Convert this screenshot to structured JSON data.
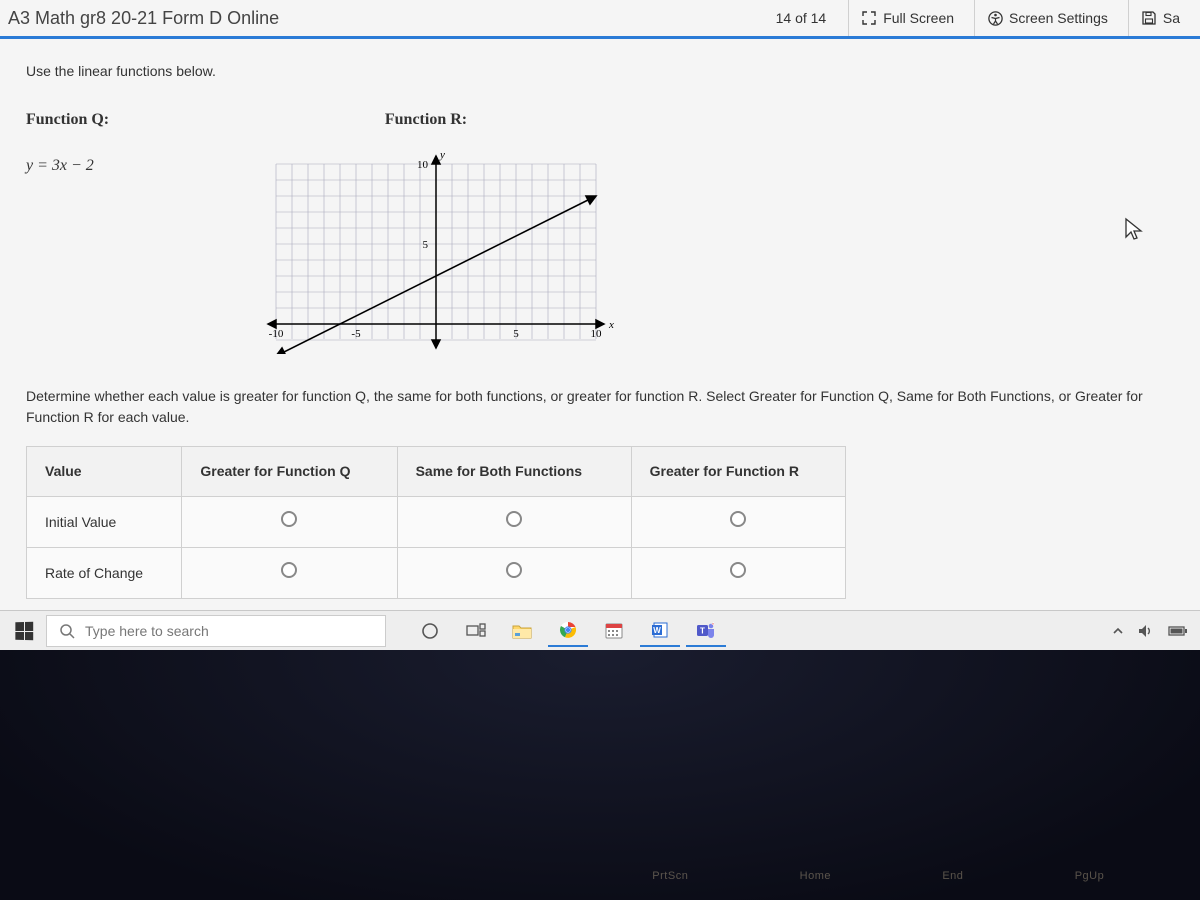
{
  "header": {
    "title": "A3 Math gr8 20-21 Form D Online",
    "page_counter": "14 of 14",
    "full_screen_label": "Full Screen",
    "screen_settings_label": "Screen Settings",
    "save_label": "Sa"
  },
  "question": {
    "prompt": "Use the linear functions below.",
    "function_q_label": "Function Q:",
    "function_q_equation": "y = 3x − 2",
    "function_r_label": "Function R:",
    "instructions": "Determine whether each value is greater for function Q, the same for both functions, or greater for function R. Select Greater for Function Q, Same for Both Functions, or Greater for Function R for each value."
  },
  "table": {
    "headers": [
      "Value",
      "Greater for Function Q",
      "Same for Both Functions",
      "Greater for Function R"
    ],
    "rows": [
      "Initial Value",
      "Rate of Change"
    ]
  },
  "chart_data": {
    "type": "line",
    "title": "Function R",
    "xlabel": "x",
    "ylabel": "y",
    "xlim": [
      -10,
      10
    ],
    "ylim": [
      -3,
      10
    ],
    "xticks": [
      -10,
      -5,
      5,
      10
    ],
    "yticks": [
      5,
      10
    ],
    "series": [
      {
        "name": "R",
        "points": [
          [
            -10,
            -2
          ],
          [
            10,
            8
          ]
        ]
      }
    ],
    "grid": true,
    "note": "approximate line through (-10,-2) rising to (10,8); slope ≈ 0.5, y-intercept ≈ 3"
  },
  "taskbar": {
    "search_placeholder": "Type here to search"
  },
  "keyboard": {
    "fn": [
      "",
      "",
      "",
      "",
      "",
      "PrtScn",
      "Home",
      "End",
      "PgUp"
    ]
  }
}
